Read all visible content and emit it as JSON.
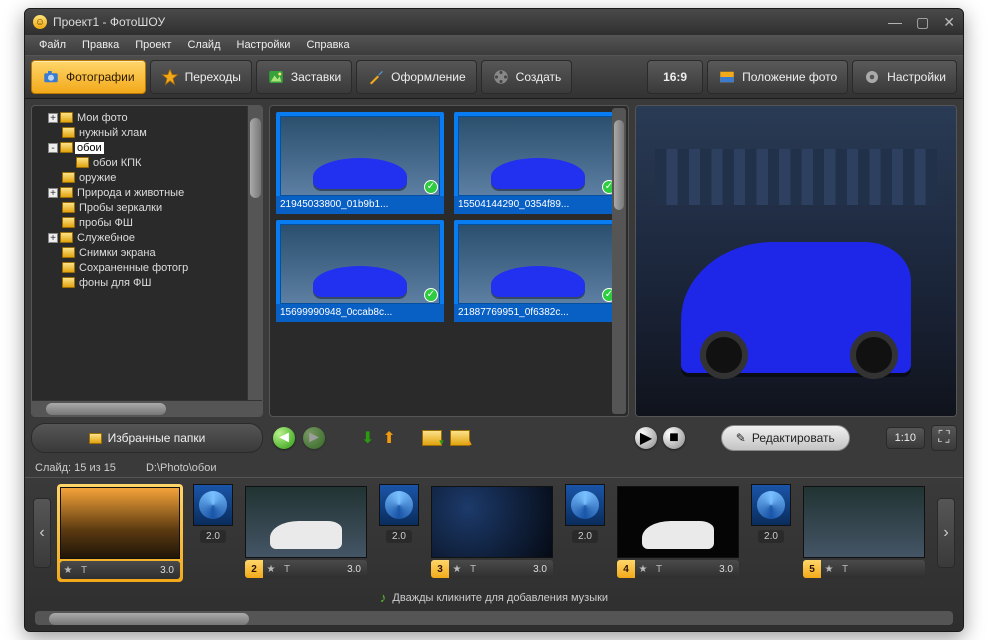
{
  "title": "Проект1 - ФотоШОУ",
  "menu": [
    "Файл",
    "Правка",
    "Проект",
    "Слайд",
    "Настройки",
    "Справка"
  ],
  "tabs": {
    "photos": "Фотографии",
    "transitions": "Переходы",
    "bumpers": "Заставки",
    "design": "Оформление",
    "create": "Создать"
  },
  "right_toolbar": {
    "ratio": "16:9",
    "position": "Положение фото",
    "settings": "Настройки"
  },
  "tree": [
    {
      "indent": 1,
      "exp": "+",
      "label": "Мои фото"
    },
    {
      "indent": 1,
      "exp": "",
      "label": "нужный хлам"
    },
    {
      "indent": 1,
      "exp": "-",
      "label": "обои",
      "selected": true
    },
    {
      "indent": 2,
      "exp": "",
      "label": "обои КПК"
    },
    {
      "indent": 1,
      "exp": "",
      "label": "оружие"
    },
    {
      "indent": 1,
      "exp": "+",
      "label": "Природа и животные"
    },
    {
      "indent": 1,
      "exp": "",
      "label": "Пробы зеркалки"
    },
    {
      "indent": 1,
      "exp": "",
      "label": "пробы ФШ"
    },
    {
      "indent": 1,
      "exp": "+",
      "label": "Служебное"
    },
    {
      "indent": 1,
      "exp": "",
      "label": "Снимки экрана"
    },
    {
      "indent": 1,
      "exp": "",
      "label": "Сохраненные фотогр"
    },
    {
      "indent": 1,
      "exp": "",
      "label": "фоны для ФШ"
    }
  ],
  "favorites_btn": "Избранные папки",
  "thumbs": [
    {
      "caption": "21945033800_01b9b1..."
    },
    {
      "caption": "15504144290_0354f89..."
    },
    {
      "caption": "15699990948_0ccab8c..."
    },
    {
      "caption": "21887769951_0f6382c..."
    }
  ],
  "preview": {
    "edit": "Редактировать",
    "time": "1:10"
  },
  "status": {
    "slide_count": "Слайд: 15 из 15",
    "path": "D:\\Photo\\обои"
  },
  "timeline": {
    "slides": [
      {
        "num": "",
        "dur": "3.0",
        "kind": "sunset"
      },
      {
        "num": "2",
        "dur": "3.0",
        "kind": "white"
      },
      {
        "num": "3",
        "dur": "3.0",
        "kind": "darkblue"
      },
      {
        "num": "4",
        "dur": "3.0",
        "kind": "black"
      },
      {
        "num": "5",
        "dur": "",
        "kind": "cut"
      }
    ],
    "trans_dur": "2.0",
    "audio_prompt": "Дважды кликните для добавления музыки"
  }
}
